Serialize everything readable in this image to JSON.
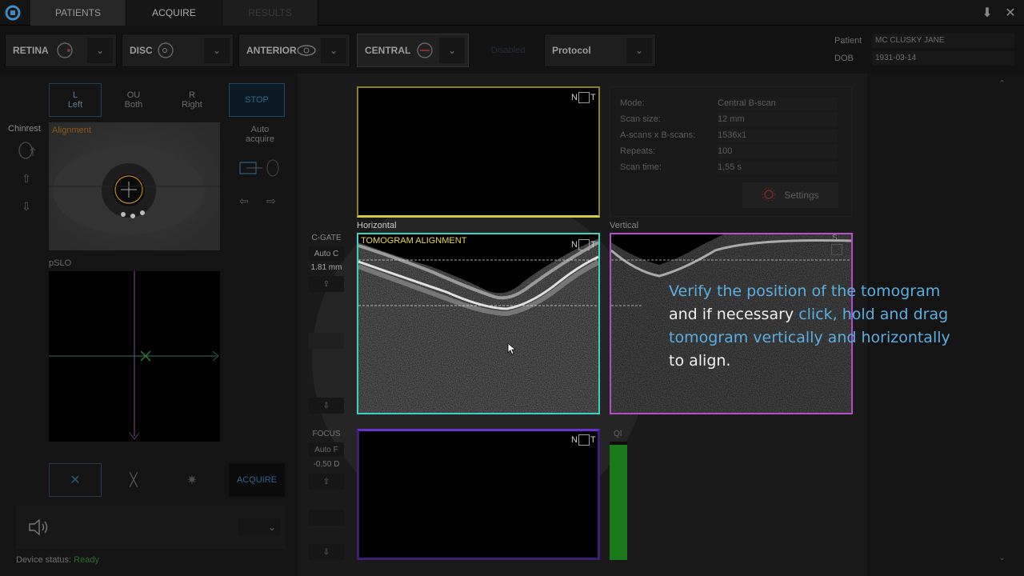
{
  "topbar": {
    "tabs": [
      "PATIENTS",
      "ACQUIRE",
      "RESULTS"
    ],
    "icons": [
      "app-logo-icon",
      "download-icon",
      "close-icon"
    ]
  },
  "modes": [
    {
      "label": "RETINA",
      "badge": "R"
    },
    {
      "label": "DISC",
      "badge": "D"
    },
    {
      "label": "ANTERIOR",
      "badge": "A"
    },
    {
      "label": "CENTRAL",
      "badge": "C"
    }
  ],
  "protocol": {
    "label": "Protocol",
    "faded_label": "Disabled"
  },
  "patient": {
    "name_label": "Patient",
    "name_value": "MC CLUSKY JANE",
    "dob_label": "DOB",
    "dob_value": "1931-03-14"
  },
  "eye_select": {
    "left": {
      "short": "L",
      "long": "Left"
    },
    "both": {
      "short": "OU",
      "long": "Both"
    },
    "right": {
      "short": "R",
      "long": "Right"
    },
    "stop": "STOP"
  },
  "chinrest": {
    "label": "Chinrest"
  },
  "alignment": {
    "label": "Alignment"
  },
  "auto_acquire": {
    "line1": "Auto",
    "line2": "acquire"
  },
  "pslo": {
    "label": "pSLO"
  },
  "cgate": {
    "label": "C-GATE",
    "auto": "Auto C",
    "value": "1.81 mm"
  },
  "focus": {
    "label": "FOCUS",
    "auto": "Auto F",
    "value": "-0,50 D"
  },
  "scan": {
    "horizontal_label": "Horizontal",
    "vertical_label": "Vertical",
    "tomogram_label": "TOMOGRAM ALIGNMENT",
    "n": "N",
    "t": "T",
    "s": "S",
    "qi_label": "QI",
    "qi_level": 0.97
  },
  "info": {
    "rows": [
      {
        "label": "Mode:",
        "value": "Central B-scan"
      },
      {
        "label": "Scan size:",
        "value": "12 mm"
      },
      {
        "label": "A-scans x B-scans:",
        "value": "1536x1"
      },
      {
        "label": "Repeats:",
        "value": "100"
      },
      {
        "label": "Scan time:",
        "value": "1,55 s"
      }
    ],
    "settings_label": "Settings"
  },
  "acquire": {
    "label": "ACQUIRE"
  },
  "device": {
    "label": "Device status:",
    "value": "Ready"
  },
  "hint": {
    "part1": "Verify the position of the tomogram",
    "part2": "and if necessary ",
    "part3": "click, hold and drag",
    "part4": "tomogram vertically and horizontally",
    "part5": "to align."
  },
  "colors": {
    "yellow": "#d8c84a",
    "cyan": "#3fd1c0",
    "magenta": "#b24fc6",
    "purple": "#6a2fd0",
    "hint_blue": "#5aaee0",
    "qi_green": "#1a7a1a"
  }
}
